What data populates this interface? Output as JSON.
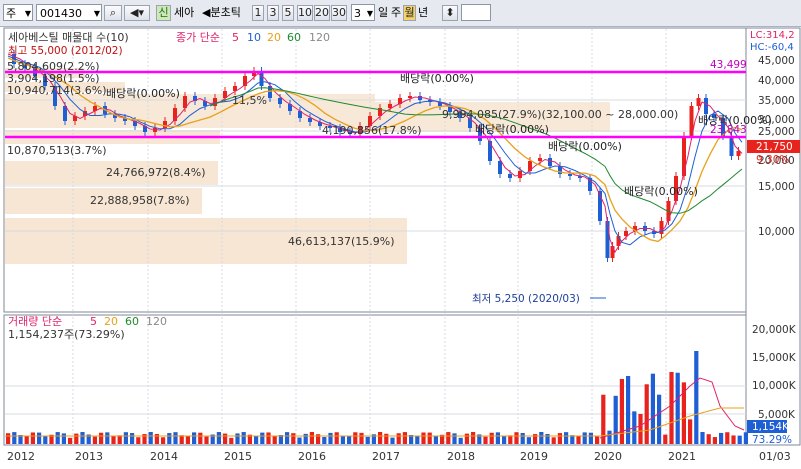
{
  "toolbar": {
    "market": "주",
    "code": "001430",
    "stock_name": "세아",
    "signal_badge": "신",
    "period_prefix": "◀분초틱",
    "periods": [
      "1",
      "3",
      "5",
      "10",
      "20",
      "30"
    ],
    "count_value": "3",
    "units": [
      "일",
      "주",
      "월",
      "년"
    ],
    "selected_unit": "월"
  },
  "price_panel": {
    "title": "세아베스틸 매물대 수(10)",
    "ma_label": "종가 단순",
    "ma_periods": [
      "5",
      "10",
      "20",
      "60",
      "120"
    ],
    "lc_label": "LC:314,2",
    "hc_label": "HC:-60,4",
    "last_price_badge": "21,750",
    "last_pct": "9.30%",
    "max_label": "최고 55,000 (2012/02)",
    "min_label": "최저 5,250 (2020/03)",
    "h_lines": [
      "43,499",
      "23,843"
    ],
    "y_ticks": [
      "45,000",
      "40,000",
      "35,000",
      "30,000",
      "25,000",
      "20,000",
      "15,000",
      "10,000"
    ],
    "dividend_label": "배당락(0.00%)",
    "volume_profile_labels": [
      "5,804,609(2.2%)",
      "3,904,198(1.5%)",
      "10,940,714(3.6%)",
      "10,870,513(3.7%)",
      "24,766,972(8.4%)",
      "22,888,958(7.8%)",
      "46,613,137(15.9%)",
      "9,994,085(27.9%)(32,100.00 ~ 28,000.00)",
      "4,190,856(17.8%)",
      "11,5%"
    ]
  },
  "volume_panel": {
    "title": "거래량 단순",
    "ma_periods": [
      "5",
      "20",
      "60",
      "120"
    ],
    "current": "1,154,237주(73.29%)",
    "y_ticks": [
      "20,000K",
      "15,000K",
      "10,000K",
      "5,000K"
    ],
    "last_volume_badge": "1,154K",
    "last_volume_pct": "73.29%"
  },
  "x_axis": {
    "labels": [
      "2012",
      "2013",
      "2014",
      "2015",
      "2016",
      "2017",
      "2018",
      "2019",
      "2020",
      "2021",
      "01/03"
    ]
  },
  "colors": {
    "up": "#e8221c",
    "down": "#1f5fd6",
    "ma5": "#e0226a",
    "ma10": "#1f5fd6",
    "ma20": "#e8a11a",
    "ma60": "#1e8a2e",
    "ma120": "#8a8a8a",
    "hline": "#ff00ff",
    "profile": "#f7e6d3"
  }
}
